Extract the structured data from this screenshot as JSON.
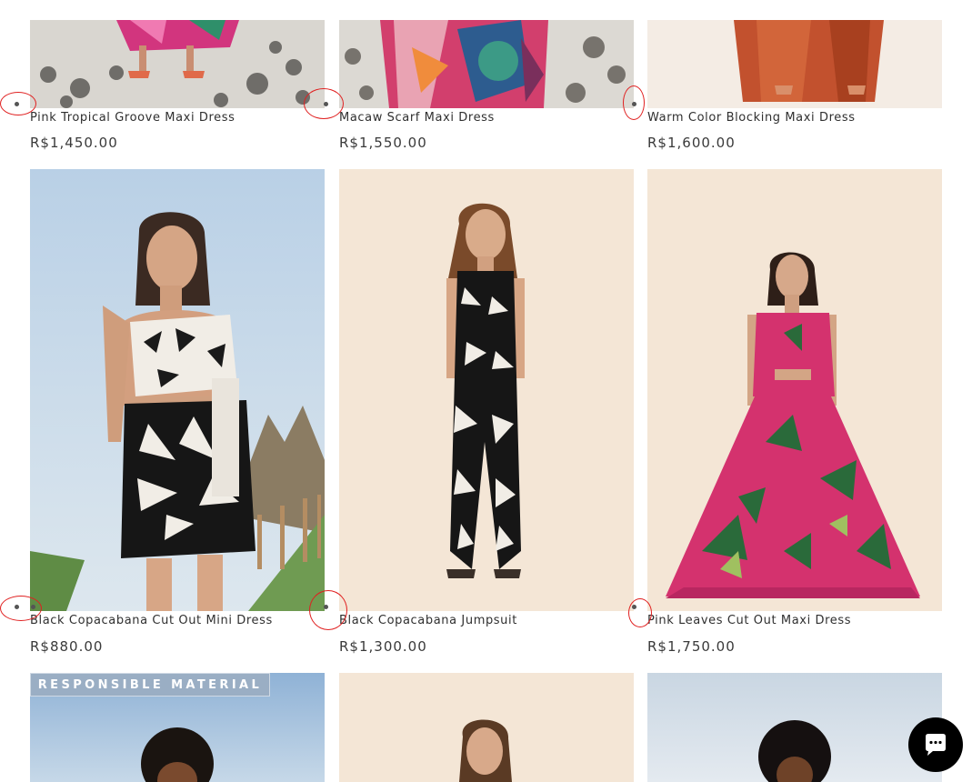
{
  "products": [
    {
      "name": "Pink Tropical Groove Maxi Dress",
      "price": "R$1,450.00"
    },
    {
      "name": "Macaw Scarf Maxi Dress",
      "price": "R$1,550.00"
    },
    {
      "name": "Warm Color Blocking Maxi Dress",
      "price": "R$1,600.00"
    },
    {
      "name": "Black Copacabana Cut Out Mini Dress",
      "price": "R$880.00"
    },
    {
      "name": "Black Copacabana Jumpsuit",
      "price": "R$1,300.00"
    },
    {
      "name": "Pink Leaves Cut Out Maxi Dress",
      "price": "R$1,750.00"
    }
  ],
  "badges": {
    "responsible": "RESPONSIBLE MATERIAL"
  },
  "icons": {
    "chat": "chat-bubble-icon",
    "carousel_dot": "carousel-dot-icon"
  },
  "colors": {
    "highlight_ring": "#e02020",
    "badge_bg": "#9aaec4",
    "chat_button": "#000000"
  }
}
